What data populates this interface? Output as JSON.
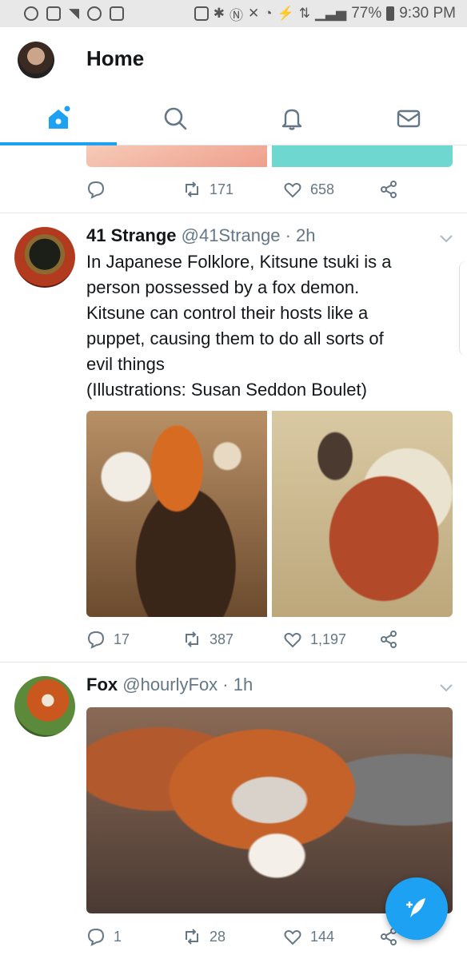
{
  "status_bar": {
    "battery": "77%",
    "time": "9:30 PM",
    "icons": [
      "record-icon",
      "mail-icon",
      "twitter-icon",
      "face-icon",
      "gallery-icon",
      "lock-icon",
      "bluetooth-icon",
      "nfc-icon",
      "mute-icon",
      "alarm-icon",
      "data-icon",
      "lte-icon",
      "signal-icon",
      "battery-icon"
    ]
  },
  "header": {
    "title": "Home"
  },
  "tabs": [
    {
      "name": "home-tab",
      "icon": "home-icon",
      "active": true
    },
    {
      "name": "search-tab",
      "icon": "search-icon",
      "active": false
    },
    {
      "name": "notifications-tab",
      "icon": "bell-icon",
      "active": false
    },
    {
      "name": "messages-tab",
      "icon": "envelope-icon",
      "active": false
    }
  ],
  "accent_color": "#1da1f2",
  "prev_tweet": {
    "reply_count": "",
    "retweet_count": "171",
    "like_count": "658"
  },
  "tweets": [
    {
      "name": "41 Strange",
      "handle": "@41Strange · 2h",
      "text_lines": [
        "In Japanese Folklore, Kitsune tsuki is a",
        "person possessed by a fox demon.",
        "Kitsune can control their hosts like a",
        "puppet, causing them to do all sorts of",
        "evil things",
        "(Illustrations: Susan Seddon Boulet)"
      ],
      "reply_count": "17",
      "retweet_count": "387",
      "like_count": "1,197"
    },
    {
      "name": "Fox",
      "handle": "@hourlyFox · 1h",
      "reply_count": "1",
      "retweet_count": "28",
      "like_count": "144"
    }
  ]
}
